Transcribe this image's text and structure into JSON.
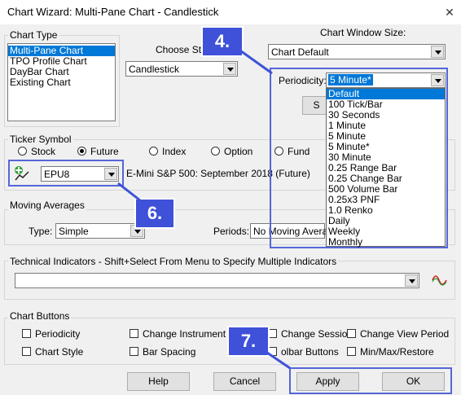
{
  "window": {
    "title": "Chart Wizard: Multi-Pane Chart - Candlestick",
    "close_glyph": "✕"
  },
  "chart_type": {
    "label": "Chart Type",
    "items": [
      "Multi-Pane Chart",
      "TPO Profile Chart",
      "DayBar Chart",
      "Existing Chart"
    ],
    "selected_index": 0
  },
  "choose_style": {
    "label": "Choose Style",
    "value": "Candlestick"
  },
  "window_size": {
    "label": "Chart Window Size:",
    "value": "Chart Default"
  },
  "periodicity": {
    "label": "Periodicity:",
    "value": "5 Minute*",
    "options": [
      "Default",
      "100 Tick/Bar",
      "30 Seconds",
      "1 Minute",
      "5 Minute",
      "5 Minute*",
      "30 Minute",
      "0.25 Range Bar",
      "0.25 Change Bar",
      "500 Volume Bar",
      "0.25x3 PNF",
      "1.0 Renko",
      "Daily",
      "Weekly",
      "Monthly"
    ],
    "selected_index": 0,
    "partial_button_text": "S"
  },
  "ticker": {
    "label": "Ticker Symbol",
    "radios": [
      {
        "label": "Stock",
        "checked": false
      },
      {
        "label": "Future",
        "checked": true
      },
      {
        "label": "Index",
        "checked": false
      },
      {
        "label": "Option",
        "checked": false
      },
      {
        "label": "Fund",
        "checked": false
      }
    ],
    "symbol": "EPU8",
    "description": "E-Mini S&P 500: September 2018 (Future)"
  },
  "moving_averages": {
    "label": "Moving Averages",
    "type_label": "Type:",
    "type_value": "Simple",
    "periods_label": "Periods:",
    "periods_value": "No Moving Averag"
  },
  "technical_indicators": {
    "label": "Technical Indicators  - Shift+Select From Menu to Specify Multiple Indicators",
    "value": ""
  },
  "chart_buttons": {
    "label": "Chart Buttons",
    "items": [
      {
        "label": "Periodicity"
      },
      {
        "label": "Change Instrument"
      },
      {
        "label": "Change Session"
      },
      {
        "label": "Change View Period"
      },
      {
        "label": "Chart Style"
      },
      {
        "label": "Bar Spacing"
      },
      {
        "label": "olbar Buttons"
      },
      {
        "label": "Min/Max/Restore"
      }
    ]
  },
  "buttons": {
    "help": "Help",
    "cancel": "Cancel",
    "apply": "Apply",
    "ok": "OK"
  },
  "callouts": {
    "c4": "4.",
    "c6": "6.",
    "c7": "7."
  },
  "colors": {
    "accent": "#3f51d8",
    "selection": "#0078d7"
  }
}
